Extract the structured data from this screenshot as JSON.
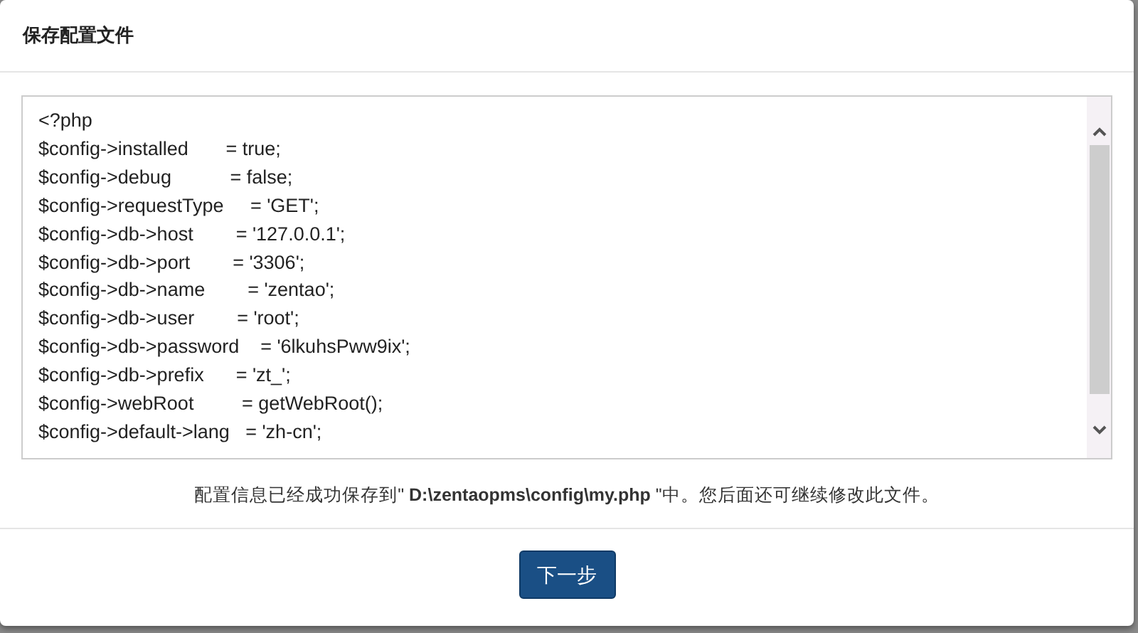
{
  "dialog": {
    "title": "保存配置文件"
  },
  "config_file": {
    "lines": [
      "<?php",
      "$config->installed       = true;",
      "$config->debug           = false;",
      "$config->requestType     = 'GET';",
      "$config->db->host        = '127.0.0.1';",
      "$config->db->port        = '3306';",
      "$config->db->name        = 'zentao';",
      "$config->db->user        = 'root';",
      "$config->db->password    = '6lkuhsPww9ix';",
      "$config->db->prefix      = 'zt_';",
      "$config->webRoot         = getWebRoot();",
      "$config->default->lang   = 'zh-cn';"
    ]
  },
  "message": "配置信息已经成功保存到\" **D:\\zentaopms\\config\\my.php** \"中。您后面还可继续修改此文件。",
  "buttons": [
    {
      "label": "下一步"
    }
  ]
}
